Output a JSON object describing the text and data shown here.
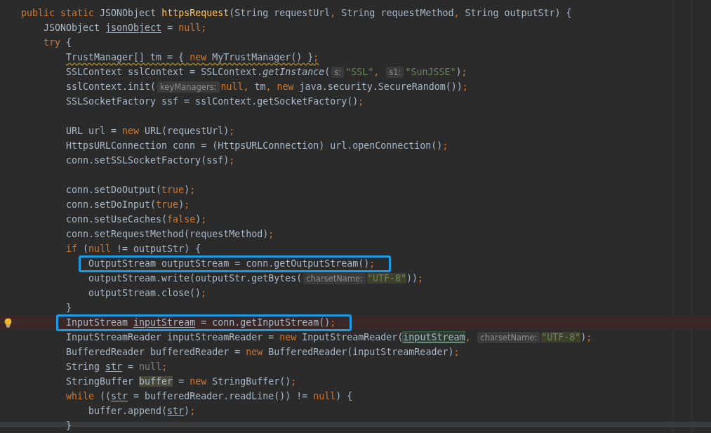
{
  "code_lines": [
    {
      "kind": "plain",
      "tokens": [
        {
          "kind": "keyword",
          "text": "public static "
        },
        {
          "kind": "text",
          "text": "JSONObject "
        },
        {
          "kind": "method-name",
          "text": "httpsRequest"
        },
        {
          "kind": "text",
          "text": "(String requestUrl"
        },
        {
          "kind": "separator",
          "text": ", "
        },
        {
          "kind": "text",
          "text": "String requestMethod"
        },
        {
          "kind": "separator",
          "text": ", "
        },
        {
          "kind": "text",
          "text": "String outputStr) {"
        }
      ],
      "children": [
        {
          "kind": "plain",
          "tokens": [
            {
              "kind": "text",
              "text": "JSONObject "
            },
            {
              "kind": "reassigned",
              "text": "jsonObject"
            },
            {
              "kind": "text",
              "text": " = "
            },
            {
              "kind": "keyword",
              "text": "null"
            },
            {
              "kind": "separator",
              "text": ";"
            }
          ]
        },
        {
          "kind": "plain",
          "tokens": [
            {
              "kind": "keyword",
              "text": "try"
            },
            {
              "kind": "text",
              "text": " {"
            }
          ],
          "children": [
            {
              "kind": "wavy",
              "tokens": [
                {
                  "kind": "text",
                  "text": "TrustManager[] tm = { "
                },
                {
                  "kind": "keyword",
                  "text": "new"
                },
                {
                  "kind": "text",
                  "text": " MyTrustManager() }"
                },
                {
                  "kind": "separator",
                  "text": ";"
                }
              ]
            },
            {
              "kind": "plain",
              "tokens": [
                {
                  "kind": "text",
                  "text": "SSLContext sslContext = SSLContext."
                },
                {
                  "kind": "static-call",
                  "text": "getInstance"
                },
                {
                  "kind": "text",
                  "text": "("
                },
                {
                  "kind": "hint",
                  "text": "s:"
                },
                {
                  "kind": "string",
                  "text": "\"SSL\""
                },
                {
                  "kind": "separator",
                  "text": ", "
                },
                {
                  "kind": "hint",
                  "text": "s1:"
                },
                {
                  "kind": "string",
                  "text": "\"SunJSSE\""
                },
                {
                  "kind": "text",
                  "text": ")"
                },
                {
                  "kind": "separator",
                  "text": ";"
                }
              ]
            },
            {
              "kind": "plain",
              "tokens": [
                {
                  "kind": "text",
                  "text": "sslContext.init("
                },
                {
                  "kind": "hint",
                  "text": "keyManagers:"
                },
                {
                  "kind": "keyword",
                  "text": "null"
                },
                {
                  "kind": "separator",
                  "text": ", "
                },
                {
                  "kind": "text",
                  "text": "tm"
                },
                {
                  "kind": "separator",
                  "text": ", "
                },
                {
                  "kind": "keyword",
                  "text": "new"
                },
                {
                  "kind": "text",
                  "text": " java.security.SecureRandom())"
                },
                {
                  "kind": "separator",
                  "text": ";"
                }
              ]
            },
            {
              "kind": "plain",
              "tokens": [
                {
                  "kind": "text",
                  "text": "SSLSocketFactory ssf = sslContext.getSocketFactory()"
                },
                {
                  "kind": "separator",
                  "text": ";"
                }
              ]
            },
            {
              "kind": "blank"
            },
            {
              "kind": "plain",
              "tokens": [
                {
                  "kind": "text",
                  "text": "URL url = "
                },
                {
                  "kind": "keyword",
                  "text": "new"
                },
                {
                  "kind": "text",
                  "text": " URL(requestUrl)"
                },
                {
                  "kind": "separator",
                  "text": ";"
                }
              ]
            },
            {
              "kind": "plain",
              "tokens": [
                {
                  "kind": "text",
                  "text": "HttpsURLConnection conn = (HttpsURLConnection) url.openConnection()"
                },
                {
                  "kind": "separator",
                  "text": ";"
                }
              ]
            },
            {
              "kind": "plain",
              "tokens": [
                {
                  "kind": "text",
                  "text": "conn.setSSLSocketFactory(ssf)"
                },
                {
                  "kind": "separator",
                  "text": ";"
                }
              ]
            },
            {
              "kind": "blank"
            },
            {
              "kind": "plain",
              "tokens": [
                {
                  "kind": "text",
                  "text": "conn.setDoOutput("
                },
                {
                  "kind": "keyword",
                  "text": "true"
                },
                {
                  "kind": "text",
                  "text": ")"
                },
                {
                  "kind": "separator",
                  "text": ";"
                }
              ]
            },
            {
              "kind": "plain",
              "tokens": [
                {
                  "kind": "text",
                  "text": "conn.setDoInput("
                },
                {
                  "kind": "keyword",
                  "text": "true"
                },
                {
                  "kind": "text",
                  "text": ")"
                },
                {
                  "kind": "separator",
                  "text": ";"
                }
              ]
            },
            {
              "kind": "plain",
              "tokens": [
                {
                  "kind": "text",
                  "text": "conn.setUseCaches("
                },
                {
                  "kind": "keyword",
                  "text": "false"
                },
                {
                  "kind": "text",
                  "text": ")"
                },
                {
                  "kind": "separator",
                  "text": ";"
                }
              ]
            },
            {
              "kind": "plain",
              "tokens": [
                {
                  "kind": "text",
                  "text": "conn.setRequestMethod(requestMethod)"
                },
                {
                  "kind": "separator",
                  "text": ";"
                }
              ]
            },
            {
              "kind": "plain",
              "tokens": [
                {
                  "kind": "keyword",
                  "text": "if"
                },
                {
                  "kind": "text",
                  "text": " ("
                },
                {
                  "kind": "keyword",
                  "text": "null"
                },
                {
                  "kind": "text",
                  "text": " != outputStr) {"
                }
              ],
              "children": [
                {
                  "kind": "boxed",
                  "tokens": [
                    {
                      "kind": "text",
                      "text": "OutputStream outputStream = conn.getOutputStream()"
                    },
                    {
                      "kind": "separator",
                      "text": ";"
                    }
                  ]
                },
                {
                  "kind": "plain",
                  "tokens": [
                    {
                      "kind": "text",
                      "text": "outputStream.write(outputStr.getBytes("
                    },
                    {
                      "kind": "hint",
                      "text": "charsetName:"
                    },
                    {
                      "kind": "marked-string",
                      "text": "\"UTF-8\""
                    },
                    {
                      "kind": "text",
                      "text": "))"
                    },
                    {
                      "kind": "separator",
                      "text": ";"
                    }
                  ]
                },
                {
                  "kind": "plain",
                  "tokens": [
                    {
                      "kind": "text",
                      "text": "outputStream.close()"
                    },
                    {
                      "kind": "separator",
                      "text": ";"
                    }
                  ]
                }
              ]
            },
            {
              "kind": "plain",
              "tokens": [
                {
                  "kind": "text",
                  "text": "}"
                }
              ]
            },
            {
              "kind": "boxed-warning",
              "tokens": [
                {
                  "kind": "text",
                  "text": "InputStream "
                },
                {
                  "kind": "reassigned",
                  "text": "inputStream"
                },
                {
                  "kind": "text",
                  "text": " = conn.getInputStream()"
                },
                {
                  "kind": "separator",
                  "text": ";"
                }
              ]
            },
            {
              "kind": "plain",
              "tokens": [
                {
                  "kind": "text",
                  "text": "InputStreamReader inputStreamReader = "
                },
                {
                  "kind": "keyword",
                  "text": "new"
                },
                {
                  "kind": "text",
                  "text": " InputStreamReader("
                },
                {
                  "kind": "marked-reassigned",
                  "text": "inputStream"
                },
                {
                  "kind": "separator",
                  "text": ", "
                },
                {
                  "kind": "hint",
                  "text": "charsetName:"
                },
                {
                  "kind": "marked-string",
                  "text": "\"UTF-8\""
                },
                {
                  "kind": "text",
                  "text": ")"
                },
                {
                  "kind": "separator",
                  "text": ";"
                }
              ]
            },
            {
              "kind": "plain",
              "tokens": [
                {
                  "kind": "text",
                  "text": "BufferedReader bufferedReader = "
                },
                {
                  "kind": "keyword",
                  "text": "new"
                },
                {
                  "kind": "text",
                  "text": " BufferedReader(inputStreamReader)"
                },
                {
                  "kind": "separator",
                  "text": ";"
                }
              ]
            },
            {
              "kind": "plain",
              "tokens": [
                {
                  "kind": "text",
                  "text": "String "
                },
                {
                  "kind": "reassigned",
                  "text": "str"
                },
                {
                  "kind": "text",
                  "text": " = "
                },
                {
                  "kind": "redundant",
                  "text": "null"
                },
                {
                  "kind": "separator",
                  "text": ";"
                }
              ]
            },
            {
              "kind": "plain",
              "tokens": [
                {
                  "kind": "text",
                  "text": "StringBuffer "
                },
                {
                  "kind": "marked",
                  "text": "buffer"
                },
                {
                  "kind": "text",
                  "text": " = "
                },
                {
                  "kind": "keyword",
                  "text": "new"
                },
                {
                  "kind": "text",
                  "text": " StringBuffer()"
                },
                {
                  "kind": "separator",
                  "text": ";"
                }
              ]
            },
            {
              "kind": "plain",
              "tokens": [
                {
                  "kind": "keyword",
                  "text": "while"
                },
                {
                  "kind": "text",
                  "text": " (("
                },
                {
                  "kind": "reassigned",
                  "text": "str"
                },
                {
                  "kind": "text",
                  "text": " = bufferedReader.readLine()) != "
                },
                {
                  "kind": "keyword",
                  "text": "null"
                },
                {
                  "kind": "text",
                  "text": ") {"
                }
              ],
              "children": [
                {
                  "kind": "plain",
                  "tokens": [
                    {
                      "kind": "text",
                      "text": "buffer.append("
                    },
                    {
                      "kind": "reassigned",
                      "text": "str"
                    },
                    {
                      "kind": "text",
                      "text": ")"
                    },
                    {
                      "kind": "separator",
                      "text": ";"
                    }
                  ]
                }
              ]
            },
            {
              "kind": "plain",
              "tokens": [
                {
                  "kind": "text",
                  "text": "}"
                }
              ]
            }
          ]
        }
      ]
    }
  ]
}
